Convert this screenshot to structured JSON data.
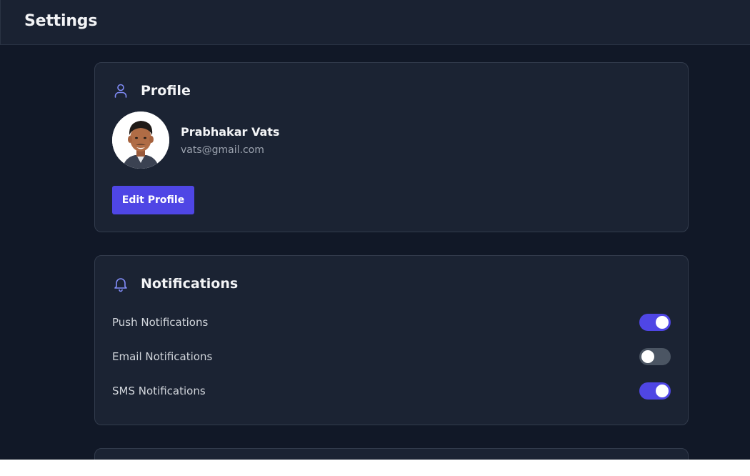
{
  "header": {
    "title": "Settings"
  },
  "profile": {
    "title": "Profile",
    "icon": "user-icon",
    "name": "Prabhakar Vats",
    "email": "vats@gmail.com",
    "edit_label": "Edit Profile"
  },
  "notifications": {
    "title": "Notifications",
    "icon": "bell-icon",
    "items": [
      {
        "label": "Push Notifications",
        "enabled": true
      },
      {
        "label": "Email Notifications",
        "enabled": false
      },
      {
        "label": "SMS Notifications",
        "enabled": true
      }
    ]
  },
  "colors": {
    "accent": "#4f46e5",
    "icon_accent": "#818cf8",
    "background": "#111827",
    "card": "#1b2333"
  }
}
